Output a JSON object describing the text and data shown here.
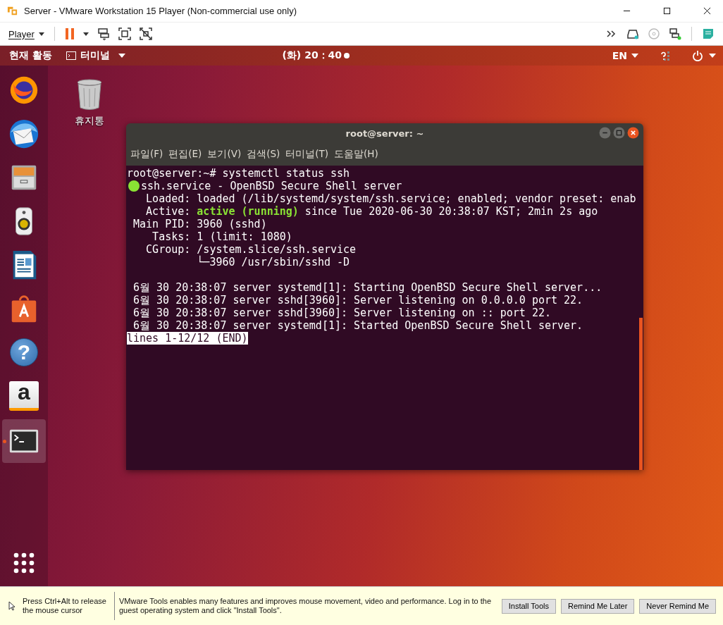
{
  "window": {
    "title": "Server - VMware Workstation 15 Player (Non-commercial use only)"
  },
  "toolbar": {
    "player_menu": "Player",
    "paused": true
  },
  "top_bar": {
    "activities": "현재 활동",
    "app_menu": "터미널",
    "clock": "(화) 20：40",
    "input_source": "EN"
  },
  "dock": [
    {
      "kind": "browser",
      "active": false
    },
    {
      "kind": "mail",
      "active": false
    },
    {
      "kind": "files",
      "active": false
    },
    {
      "kind": "music",
      "active": false
    },
    {
      "kind": "writer",
      "active": false
    },
    {
      "kind": "store",
      "active": false
    },
    {
      "kind": "help",
      "glyph": "?",
      "active": false
    },
    {
      "kind": "shop",
      "glyph": "a",
      "active": false
    },
    {
      "kind": "terminal",
      "active": true
    }
  ],
  "desktop_icons": [
    {
      "label": "휴지통"
    }
  ],
  "terminal": {
    "title": "root@server: ~",
    "menu": [
      "파일(F)",
      "편집(E)",
      "보기(V)",
      "검색(S)",
      "터미널(T)",
      "도움말(H)"
    ],
    "lines": [
      {
        "kind": "text",
        "segments": [
          {
            "kind": "plain",
            "text": "root@server:~# systemctl status ssh"
          }
        ]
      },
      {
        "kind": "bullet",
        "segments": [
          {
            "kind": "plain",
            "text": "ssh.service - OpenBSD Secure Shell server"
          }
        ]
      },
      {
        "kind": "text",
        "segments": [
          {
            "kind": "plain",
            "text": "   Loaded: loaded (/lib/systemd/system/ssh.service; enabled; vendor preset: enab"
          }
        ]
      },
      {
        "kind": "text",
        "segments": [
          {
            "kind": "plain",
            "text": "   Active: "
          },
          {
            "kind": "status",
            "text": "active (running)"
          },
          {
            "kind": "plain",
            "text": " since Tue 2020-06-30 20:38:07 KST; 2min 2s ago"
          }
        ]
      },
      {
        "kind": "text",
        "segments": [
          {
            "kind": "plain",
            "text": " Main PID: 3960 (sshd)"
          }
        ]
      },
      {
        "kind": "text",
        "segments": [
          {
            "kind": "plain",
            "text": "    Tasks: 1 (limit: 1080)"
          }
        ]
      },
      {
        "kind": "text",
        "segments": [
          {
            "kind": "plain",
            "text": "   CGroup: /system.slice/ssh.service"
          }
        ]
      },
      {
        "kind": "text",
        "segments": [
          {
            "kind": "plain",
            "text": "           └─3960 /usr/sbin/sshd -D"
          }
        ]
      },
      {
        "kind": "blank"
      },
      {
        "kind": "text",
        "segments": [
          {
            "kind": "plain",
            "text": " 6월 30 20:38:07 server systemd[1]: Starting OpenBSD Secure Shell server..."
          }
        ]
      },
      {
        "kind": "text",
        "segments": [
          {
            "kind": "plain",
            "text": " 6월 30 20:38:07 server sshd[3960]: Server listening on 0.0.0.0 port 22."
          }
        ]
      },
      {
        "kind": "text",
        "segments": [
          {
            "kind": "plain",
            "text": " 6월 30 20:38:07 server sshd[3960]: Server listening on :: port 22."
          }
        ]
      },
      {
        "kind": "text",
        "segments": [
          {
            "kind": "plain",
            "text": " 6월 30 20:38:07 server systemd[1]: Started OpenBSD Secure Shell server."
          }
        ]
      },
      {
        "kind": "pager",
        "segments": [
          {
            "kind": "plain",
            "text": "lines 1-12/12 (END)"
          }
        ]
      }
    ]
  },
  "notification": {
    "hint": "Press Ctrl+Alt to release the mouse cursor",
    "message": "VMware Tools enables many features and improves mouse movement, video and performance. Log in to the guest operating system and click \"Install Tools\".",
    "buttons": [
      "Install Tools",
      "Remind Me Later",
      "Never Remind Me"
    ]
  }
}
